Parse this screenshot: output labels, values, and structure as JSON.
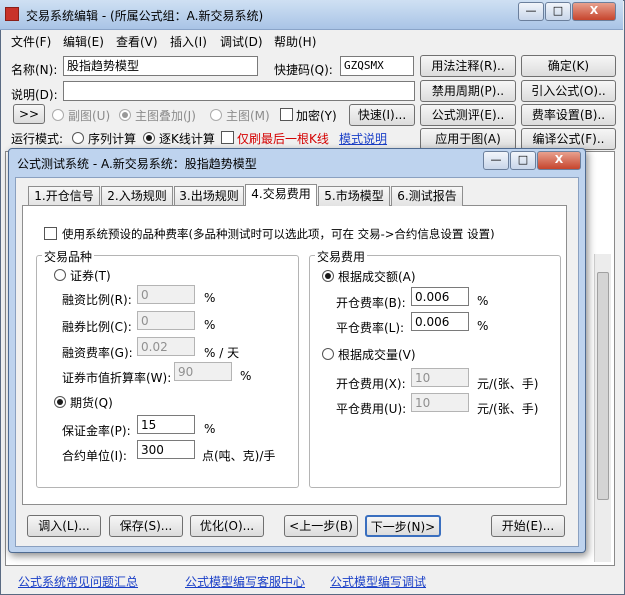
{
  "window": {
    "title": "交易系统编辑 - (所属公式组：A.新交易系统)",
    "min_label": "—",
    "max_label": "□",
    "close_label": "X"
  },
  "menu": [
    "文件(F)",
    "编辑(E)",
    "查看(V)",
    "插入(I)",
    "调试(D)",
    "帮助(H)"
  ],
  "editor": {
    "name_label": "名称(N):",
    "name_value": "股指趋势模型",
    "shortcut_label": "快捷码(Q):",
    "shortcut_value": "GZQSMX",
    "desc_label": "说明(D):",
    "desc_value": "",
    "expand_label": ">>",
    "sub_chart_label": "副图(U)",
    "main_overlay_label": "主图叠加(J)",
    "main_chart_label": "主图(M)",
    "encrypt_label": "加密(Y)",
    "fast_label": "快速(I)...",
    "run_mode_label": "运行模式:",
    "seq_calc_label": "序列计算",
    "kline_calc_label": "逐K线计算",
    "last_only_label": "仅刷最后一根K线",
    "mode_desc_link": "模式说明",
    "right_buttons": [
      "用法注释(R)..",
      "确定(K)",
      "禁用周期(P)..",
      "引入公式(O)..",
      "公式测评(E)..",
      "费率设置(B)..",
      "应用于图(A)",
      "编译公式(F).."
    ]
  },
  "dialog": {
    "title": "公式测试系统 - A.新交易系统：股指趋势模型",
    "tabs": [
      "1.开仓信号",
      "2.入场规则",
      "3.出场规则",
      "4.交易费用",
      "5.市场模型",
      "6.测试报告"
    ],
    "active_tab": 3,
    "use_preset_label": "使用系统预设的品种费率(多品种测试时可以选此项，可在 交易->合约信息设置 设置)",
    "variety_group": "交易品种",
    "securities_label": "证券(T)",
    "margin_ratio_label": "融资比例(R):",
    "margin_ratio_value": "0",
    "short_ratio_label": "融券比例(C):",
    "short_ratio_value": "0",
    "margin_rate_label": "融资费率(G):",
    "margin_rate_value": "0.02",
    "margin_rate_unit": "% / 天",
    "market_discount_label": "证券市值折算率(W):",
    "market_discount_value": "90",
    "percent": "%",
    "futures_label": "期货(Q)",
    "deposit_label": "保证金率(P):",
    "deposit_value": "15",
    "contract_unit_label": "合约单位(I):",
    "contract_unit_value": "300",
    "contract_unit_suffix": "点(吨、克)/手",
    "fee_group": "交易费用",
    "by_amount_label": "根据成交额(A)",
    "open_rate_label": "开仓费率(B):",
    "open_rate_value": "0.006",
    "close_rate_label": "平仓费率(L):",
    "close_rate_value": "0.006",
    "by_volume_label": "根据成交量(V)",
    "open_fee_label": "开仓费用(X):",
    "open_fee_value": "10",
    "close_fee_label": "平仓费用(U):",
    "close_fee_value": "10",
    "fee_unit": "元/(张、手)",
    "buttons": {
      "import": "调入(L)...",
      "save": "保存(S)...",
      "optimize": "优化(O)...",
      "prev": "<上一步(B)",
      "next": "下一步(N)>",
      "start": "开始(E)..."
    }
  },
  "footer_links": [
    "公式系统常见问题汇总",
    "公式模型编写客服中心",
    "公式模型编写调试"
  ],
  "colors": {
    "title_bar": "#bcd2ee",
    "link": "#1a3fc7",
    "warn": "#d40000"
  }
}
